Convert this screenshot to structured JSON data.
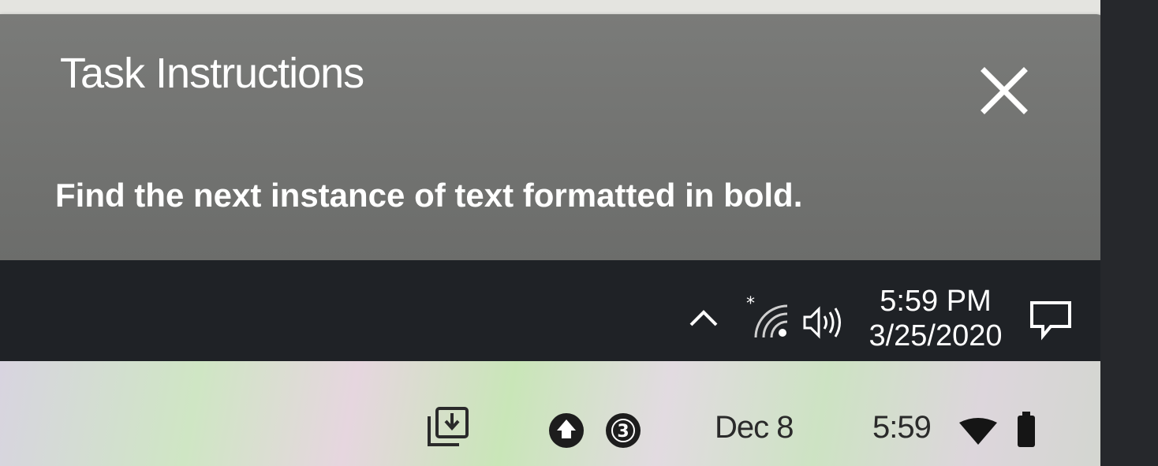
{
  "task_panel": {
    "title": "Task Instructions",
    "instruction": "Find the next instance of text formatted in bold.",
    "close_icon": "close-icon"
  },
  "windows_taskbar": {
    "tray_icons": [
      "chevron-up-icon",
      "wifi-icon",
      "volume-icon",
      "notification-icon"
    ],
    "time": "5:59 PM",
    "date": "3/25/2020"
  },
  "chromebook_shelf": {
    "icons": [
      "download-icon",
      "notification-badge-icon",
      "notification-count-icon",
      "wifi-icon",
      "battery-icon"
    ],
    "notification_count": "3",
    "date": "Dec 8",
    "time": "5:59"
  },
  "colors": {
    "panel_bg": "#727371",
    "taskbar_bg": "#1f2226",
    "text_light": "#ffffff",
    "text_dark": "#2a2a2a"
  }
}
